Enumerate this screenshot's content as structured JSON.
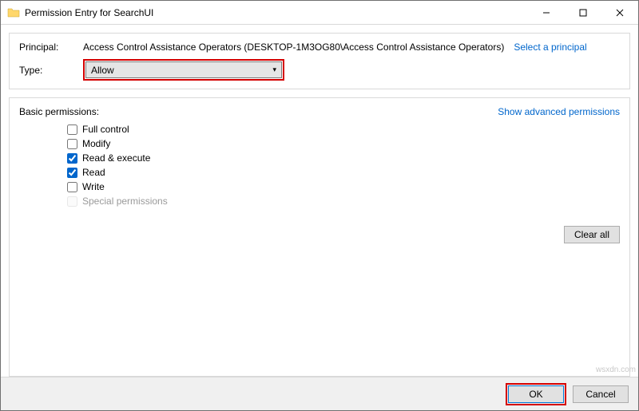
{
  "window": {
    "title": "Permission Entry for SearchUI"
  },
  "top": {
    "principal_label": "Principal:",
    "principal_value": "Access Control Assistance Operators (DESKTOP-1M3OG80\\Access Control Assistance Operators)",
    "select_principal": "Select a principal",
    "type_label": "Type:",
    "type_value": "Allow"
  },
  "main": {
    "basic_label": "Basic permissions:",
    "show_advanced": "Show advanced permissions",
    "perms": {
      "full_control": "Full control",
      "modify": "Modify",
      "read_execute": "Read & execute",
      "read": "Read",
      "write": "Write",
      "special": "Special permissions"
    },
    "clear_all": "Clear all"
  },
  "footer": {
    "ok": "OK",
    "cancel": "Cancel"
  },
  "watermark": "wsxdn.com"
}
